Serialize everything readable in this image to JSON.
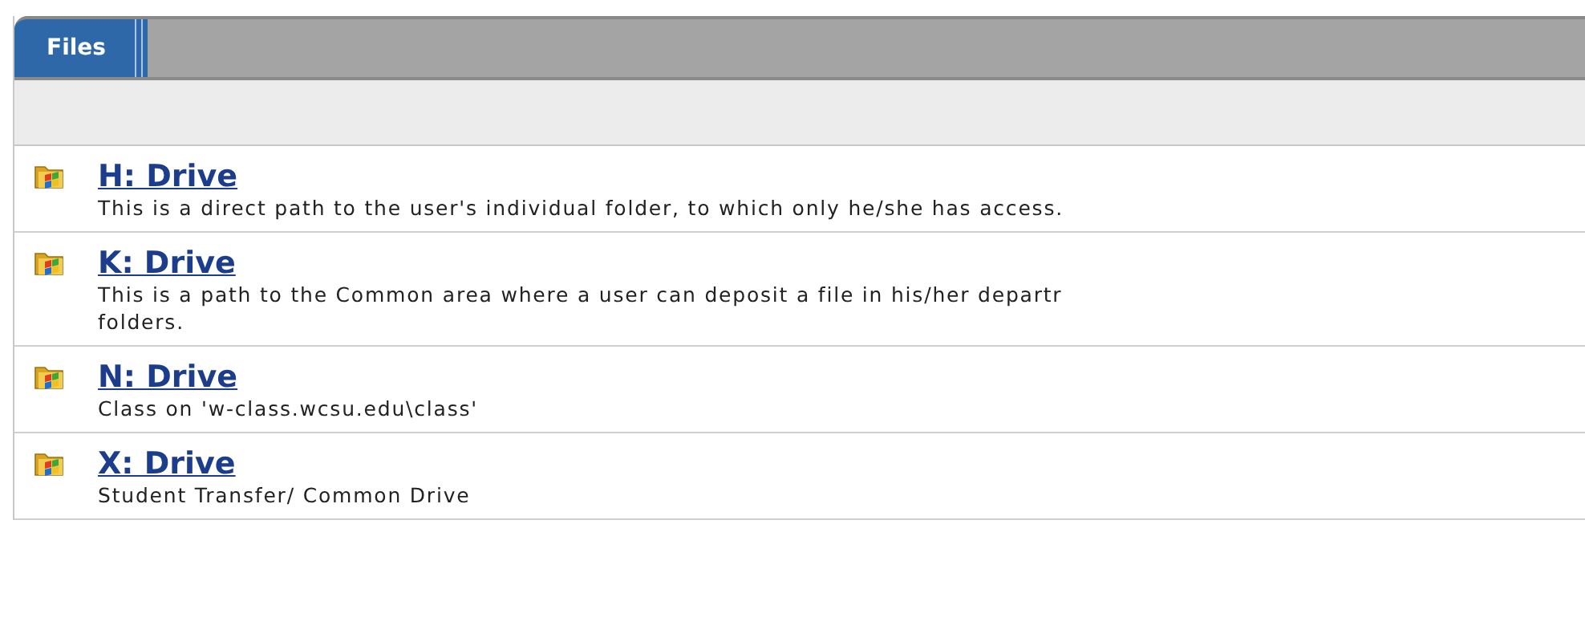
{
  "tabs": [
    {
      "label": "Files",
      "selected": true
    }
  ],
  "items": [
    {
      "title": "H: Drive",
      "description": [
        "This is a direct path to the user's individual folder, to which only he/she has access."
      ]
    },
    {
      "title": "K: Drive",
      "description": [
        "This is a path to the Common area where a user can deposit a file in his/her departr",
        "folders."
      ]
    },
    {
      "title": "N: Drive",
      "description": [
        "Class on 'w-class.wcsu.edu\\class'"
      ]
    },
    {
      "title": "X: Drive",
      "description": [
        "Student Transfer/ Common Drive"
      ]
    }
  ]
}
